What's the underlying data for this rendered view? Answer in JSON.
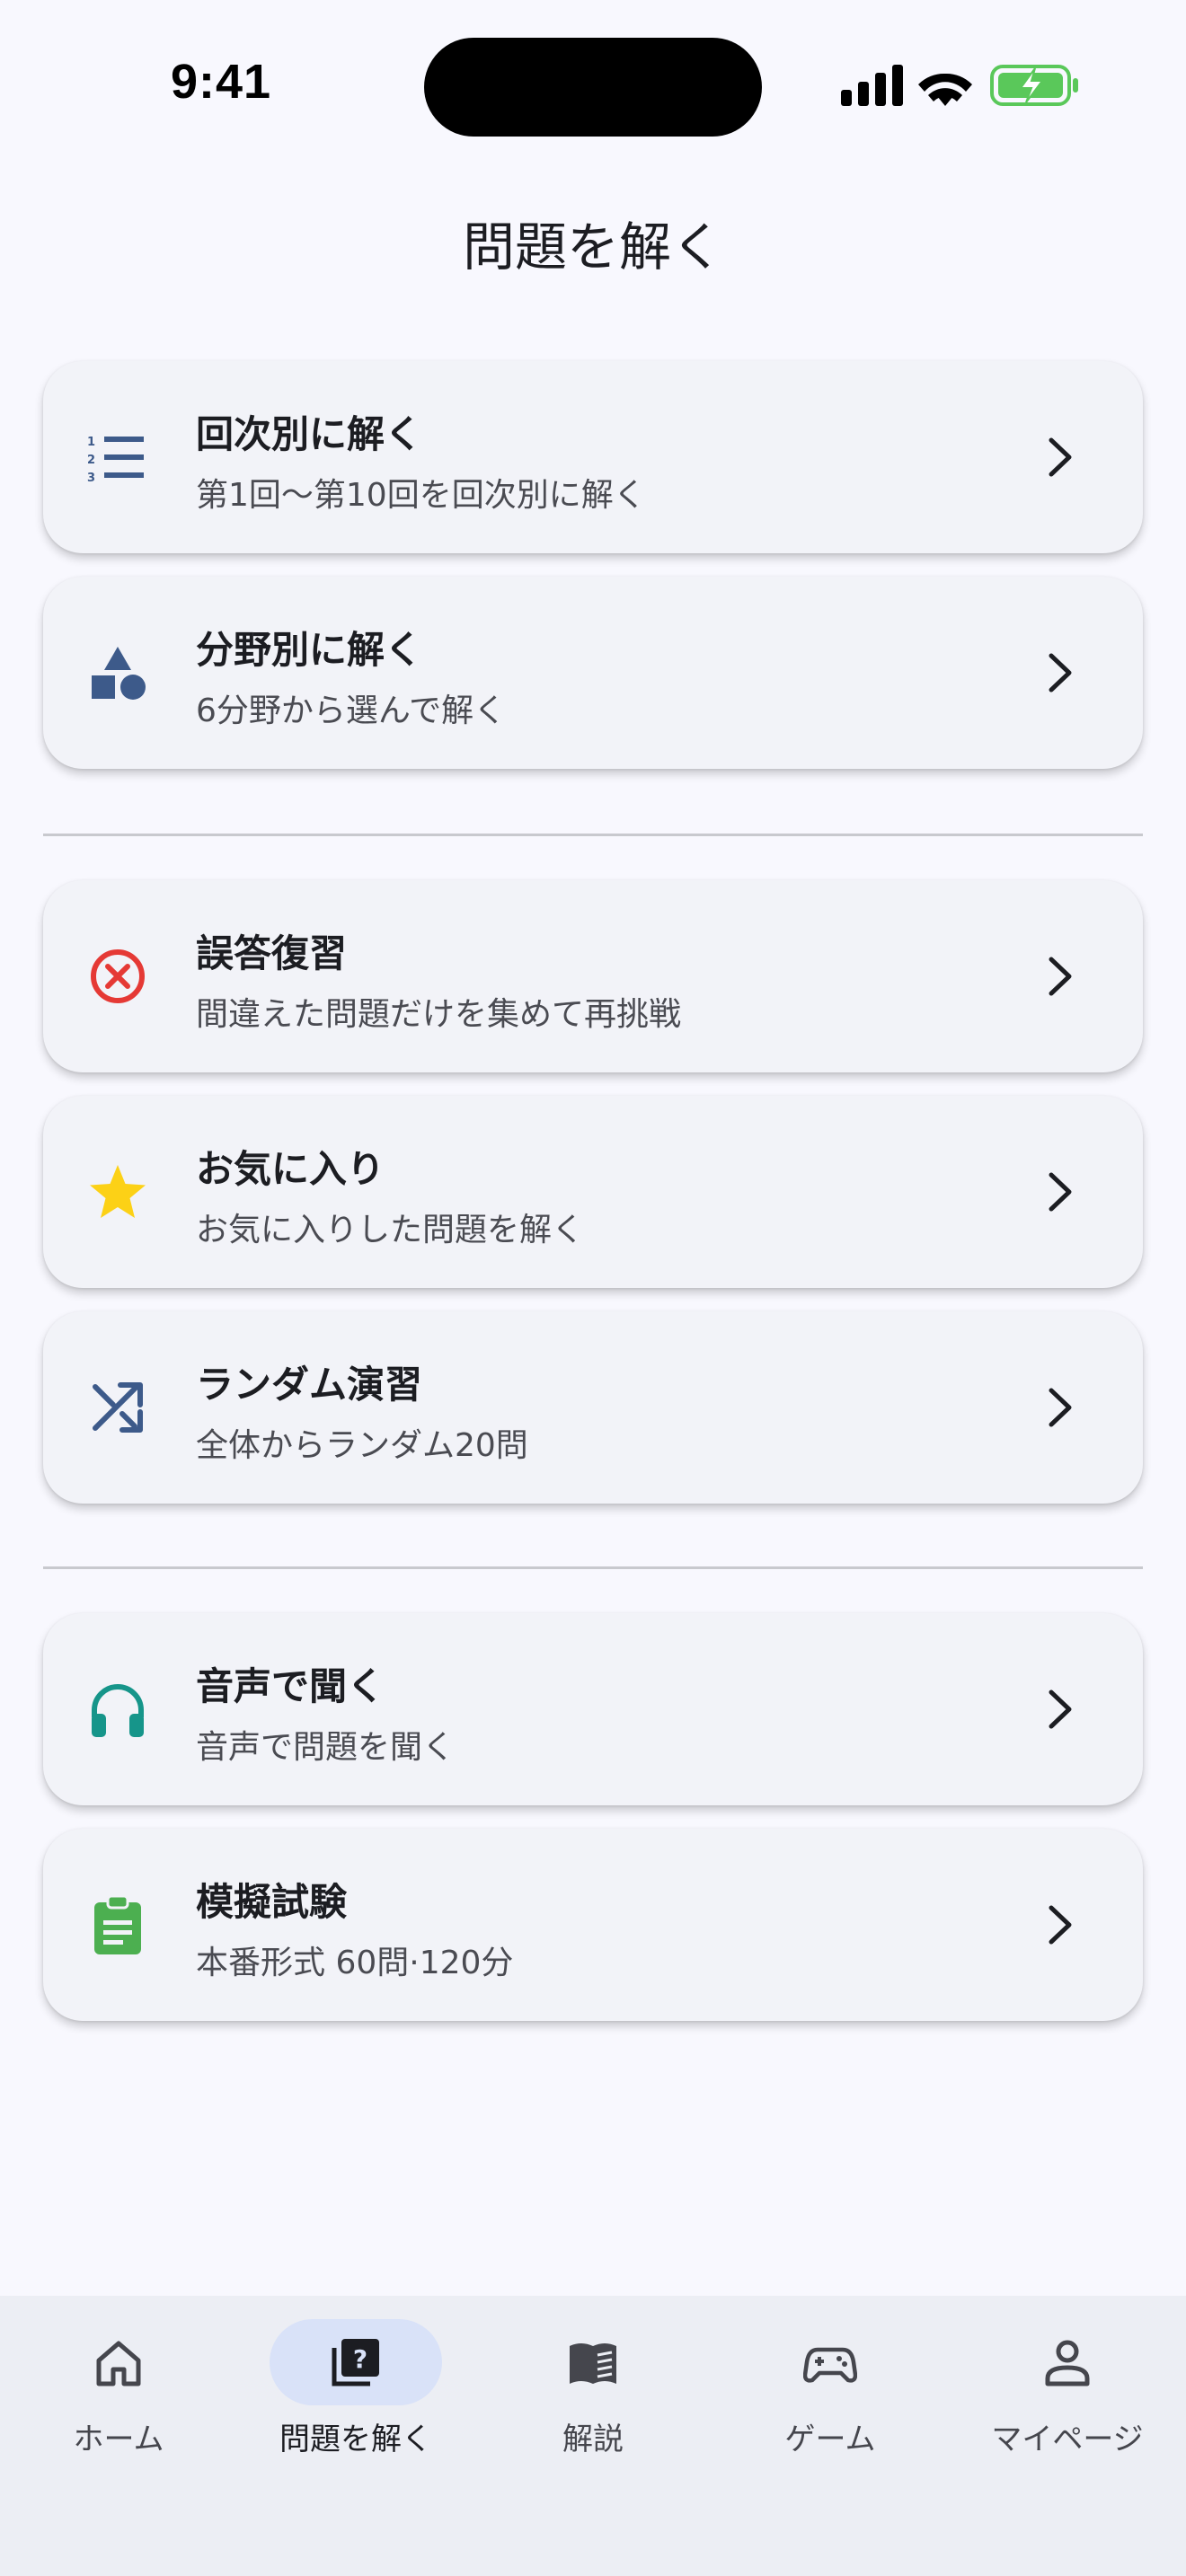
{
  "status_bar": {
    "time": "9:41"
  },
  "header": {
    "title": "問題を解く"
  },
  "menu": [
    {
      "title": "回次別に解く",
      "subtitle": "第1回～第10回を回次別に解く",
      "icon": "numbered-list-icon"
    },
    {
      "title": "分野別に解く",
      "subtitle": "6分野から選んで解く",
      "icon": "category-shapes-icon"
    },
    {
      "title": "誤答復習",
      "subtitle": "間違えた問題だけを集めて再挑戦",
      "icon": "cancel-circle-icon"
    },
    {
      "title": "お気に入り",
      "subtitle": "お気に入りした問題を解く",
      "icon": "star-icon"
    },
    {
      "title": "ランダム演習",
      "subtitle": "全体からランダム20問",
      "icon": "shuffle-icon"
    },
    {
      "title": "音声で聞く",
      "subtitle": "音声で問題を聞く",
      "icon": "headphones-icon"
    },
    {
      "title": "模擬試験",
      "subtitle": "本番形式 60問·120分",
      "icon": "clipboard-icon"
    }
  ],
  "bottom_nav": [
    {
      "label": "ホーム",
      "icon": "home-icon",
      "active": false
    },
    {
      "label": "問題を解く",
      "icon": "quiz-icon",
      "active": true
    },
    {
      "label": "解説",
      "icon": "book-icon",
      "active": false
    },
    {
      "label": "ゲーム",
      "icon": "gamepad-icon",
      "active": false
    },
    {
      "label": "マイページ",
      "icon": "person-icon",
      "active": false
    }
  ],
  "colors": {
    "accent_blue": "#3d5a8a",
    "error_red": "#e53935",
    "star_yellow": "#fcd116",
    "teal": "#16958a",
    "green": "#4caf50",
    "battery_green": "#5ac85a",
    "nav_active_bg": "#d9e2f8"
  }
}
